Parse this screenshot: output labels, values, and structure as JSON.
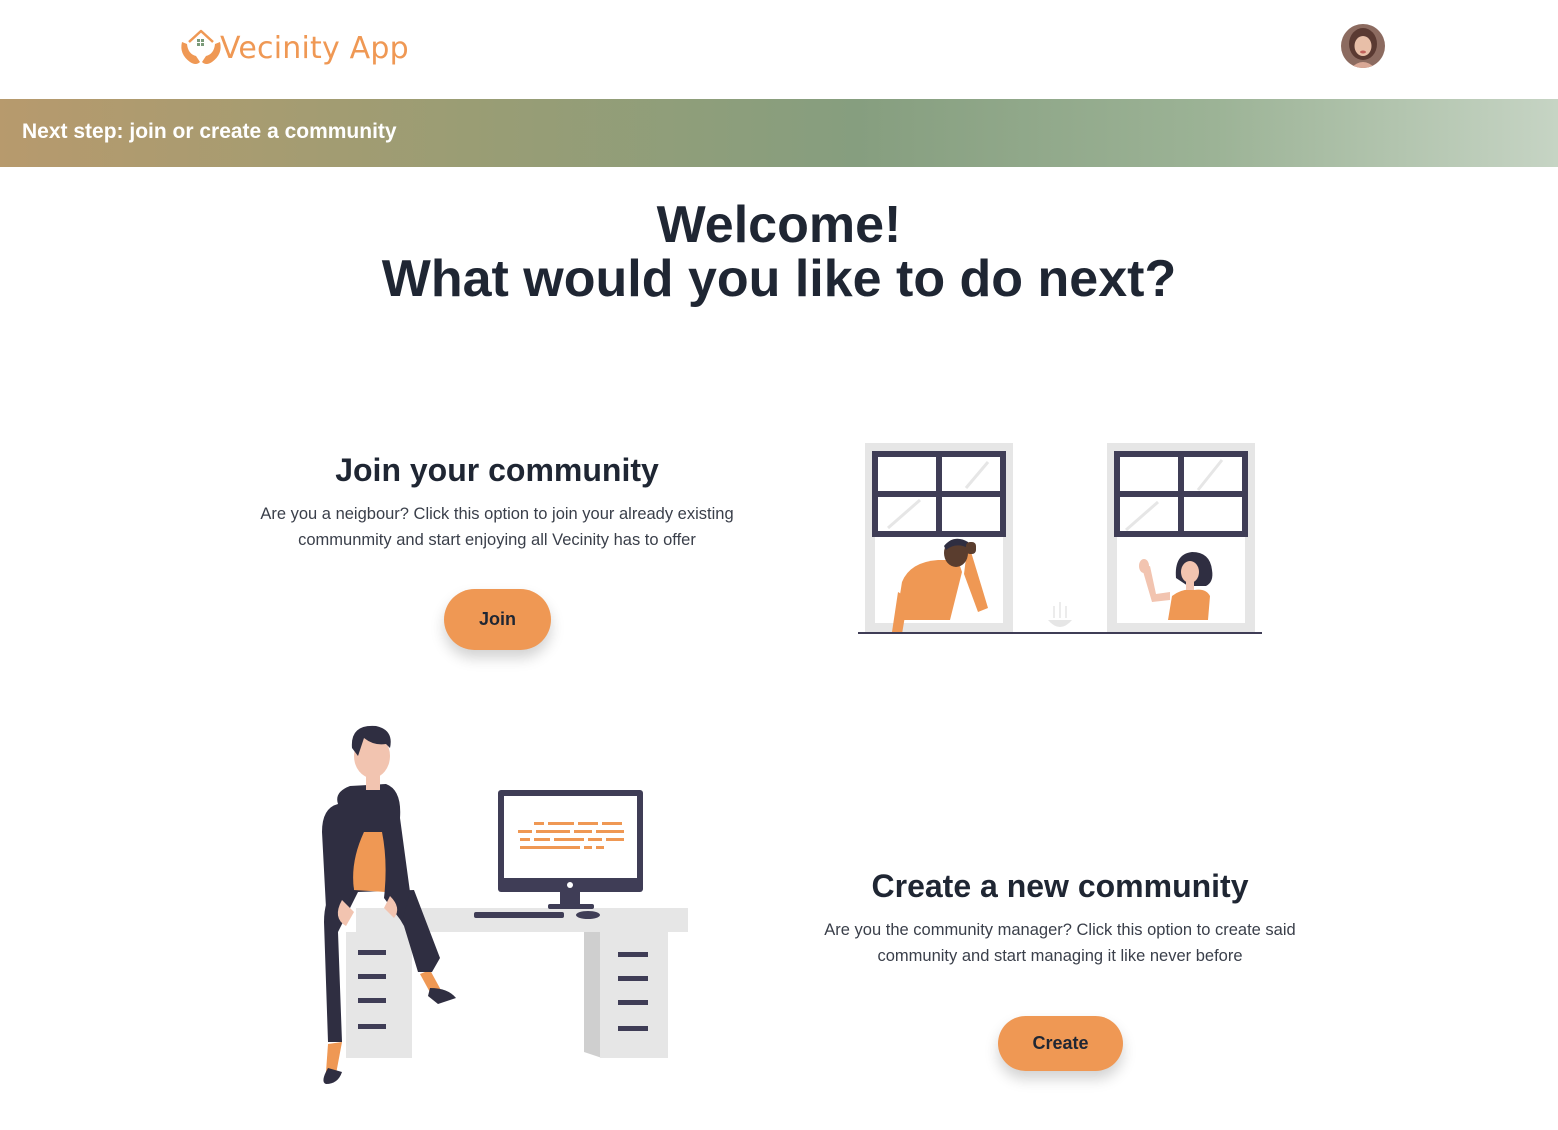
{
  "header": {
    "app_name": "Vecinity App",
    "logo_icon": "hands-house-icon",
    "avatar_icon": "user-avatar"
  },
  "banner": {
    "text": "Next step: join or create a community"
  },
  "welcome": {
    "line1": "Welcome!",
    "line2": "What would you like to do next?"
  },
  "join": {
    "title": "Join your community",
    "description_line1": "Are you a neigbour? Click this option to join your already existing",
    "description_line2": "communmity and start enjoying all Vecinity has to offer",
    "button_label": "Join"
  },
  "create": {
    "title": "Create a new community",
    "description_line1": "Are you the community manager? Click this option to create said",
    "description_line2": "community and start managing it like never before",
    "button_label": "Create"
  },
  "colors": {
    "accent": "#ef9854",
    "text": "#1f2633",
    "dark_illustration": "#3f3d56"
  }
}
